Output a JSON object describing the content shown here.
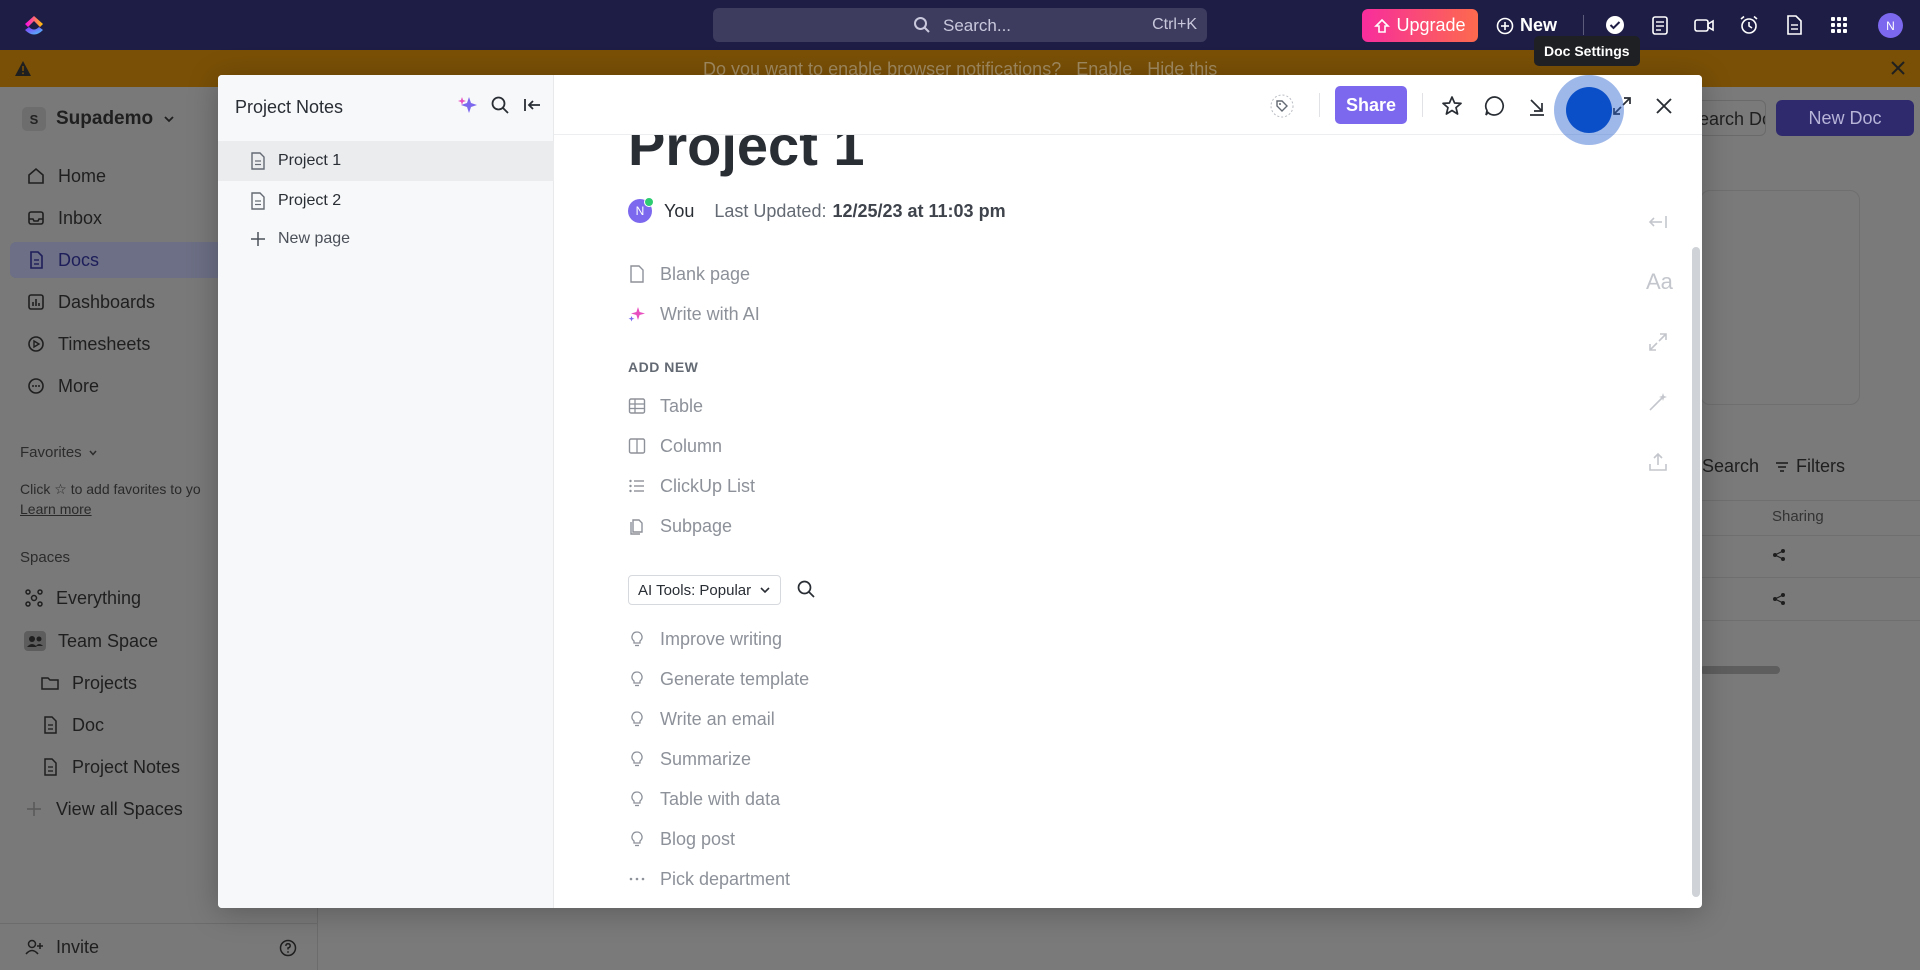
{
  "topbar": {
    "search_placeholder": "Search...",
    "search_shortcut": "Ctrl+K",
    "upgrade_label": "Upgrade",
    "new_label": "New",
    "avatar_initial": "N"
  },
  "notification": {
    "text": "Do you want to enable browser notifications?   Enable   Hide this"
  },
  "sidebar": {
    "workspace_initial": "S",
    "workspace_name": "Supademo",
    "nav": [
      {
        "label": "Home",
        "icon": "home-icon"
      },
      {
        "label": "Inbox",
        "icon": "inbox-icon"
      },
      {
        "label": "Docs",
        "icon": "docs-icon"
      },
      {
        "label": "Dashboards",
        "icon": "dashboards-icon"
      },
      {
        "label": "Timesheets",
        "icon": "timesheets-icon"
      },
      {
        "label": "More",
        "icon": "more-icon"
      }
    ],
    "favorites_title": "Favorites",
    "favorites_hint_1": "Click",
    "favorites_hint_2": "to add favorites to yo",
    "favorites_link": "Learn more",
    "spaces_title": "Spaces",
    "spaces": [
      {
        "label": "Everything"
      },
      {
        "label": "Team Space"
      },
      {
        "label": "Projects"
      },
      {
        "label": "Doc"
      },
      {
        "label": "Project Notes"
      },
      {
        "label": "View all Spaces"
      }
    ],
    "invite_label": "Invite"
  },
  "background": {
    "search_docs": "Search Docs",
    "new_doc": "New Doc",
    "search_label": "Search",
    "filters_label": "Filters",
    "sharing_label": "Sharing"
  },
  "modal": {
    "sidebar_title": "Project Notes",
    "pages": [
      {
        "label": "Project 1"
      },
      {
        "label": "Project 2"
      }
    ],
    "new_page": "New page",
    "share_label": "Share",
    "tooltip": "Doc Settings",
    "doc_title": "Project 1",
    "author": "You",
    "author_initial": "N",
    "last_updated_label": "Last Updated:",
    "last_updated_value": "12/25/23 at 11:03 pm",
    "start_options": [
      {
        "label": "Blank page",
        "icon": "blank-page-icon"
      },
      {
        "label": "Write with AI",
        "icon": "sparkle-icon"
      }
    ],
    "add_new_title": "ADD NEW",
    "add_new": [
      {
        "label": "Table",
        "icon": "table-icon"
      },
      {
        "label": "Column",
        "icon": "column-icon"
      },
      {
        "label": "ClickUp List",
        "icon": "list-icon"
      },
      {
        "label": "Subpage",
        "icon": "subpage-icon"
      }
    ],
    "ai_tools_select": "AI Tools: Popular",
    "ai_tools": [
      {
        "label": "Improve writing"
      },
      {
        "label": "Generate template"
      },
      {
        "label": "Write an email"
      },
      {
        "label": "Summarize"
      },
      {
        "label": "Table with data"
      },
      {
        "label": "Blog post"
      },
      {
        "label": "Pick department"
      }
    ],
    "font_tool_label": "Aa"
  },
  "colors": {
    "accent": "#7b68ee",
    "topbar": "#1e1d45",
    "upgrade_start": "#f72d9d",
    "upgrade_end": "#fd6a4d",
    "highlight": "#0b4fc8"
  }
}
